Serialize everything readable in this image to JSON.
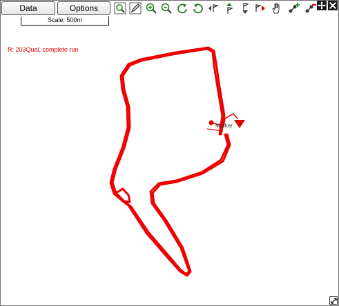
{
  "toolbar": {
    "data_label": "Data",
    "options_label": "Options",
    "tools": [
      "zoom-region-icon",
      "edit-icon",
      "zoom-in-icon",
      "zoom-out-icon",
      "rotate-clockwise-icon",
      "rotate-counterclockwise-icon",
      "previous-lap-icon",
      "flag-up-icon",
      "flag-down-icon",
      "next-lap-icon",
      "hand-pan-icon",
      "add-node-icon",
      "remove-node-icon"
    ],
    "window_controls": [
      "move-icon",
      "close-icon"
    ]
  },
  "map": {
    "scale_label": "Scale: 500m",
    "run_label": "R:  203Qual, complete run",
    "marker_label": "Marker",
    "track_color": "#ee0000"
  }
}
